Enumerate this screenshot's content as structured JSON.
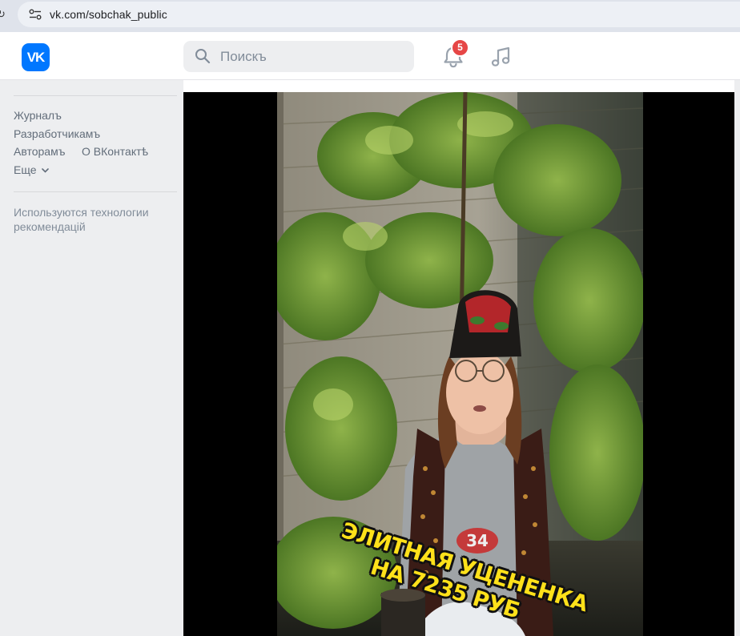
{
  "browser": {
    "url": "vk.com/sobchak_public"
  },
  "header": {
    "logo_text": "VK",
    "search_placeholder": "Поискъ",
    "notifications_count": "5",
    "icons": [
      "vk-logo-icon",
      "search-icon",
      "bell-icon",
      "music-note-icon"
    ],
    "brand_color": "#0077ff",
    "badge_color": "#e64646"
  },
  "sidebar": {
    "links": [
      {
        "label": "Журналъ"
      },
      {
        "label": "Разработчикамъ"
      },
      {
        "label": "Авторамъ"
      },
      {
        "label": "О ВКонтактѣ"
      },
      {
        "label": "Еще"
      }
    ],
    "tech_note": "Используются технологии рекомендацій"
  },
  "video": {
    "caption_line1": "ЭЛИТНАЯ УЦЕНЕНКА",
    "caption_line2": "НА 7235 РУБ",
    "shirt_number": "34"
  }
}
